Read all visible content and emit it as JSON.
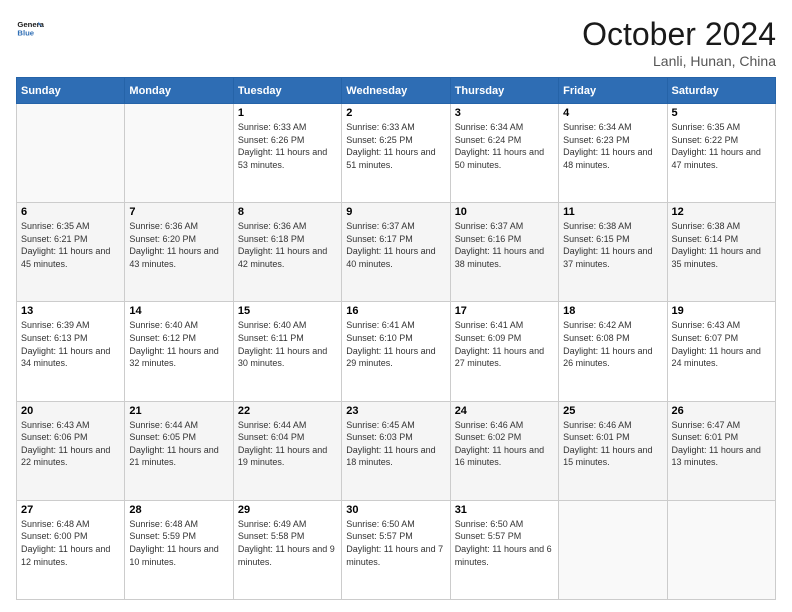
{
  "header": {
    "logo_line1": "General",
    "logo_line2": "Blue",
    "month": "October 2024",
    "location": "Lanli, Hunan, China"
  },
  "weekdays": [
    "Sunday",
    "Monday",
    "Tuesday",
    "Wednesday",
    "Thursday",
    "Friday",
    "Saturday"
  ],
  "weeks": [
    [
      {
        "day": "",
        "info": ""
      },
      {
        "day": "",
        "info": ""
      },
      {
        "day": "1",
        "info": "Sunrise: 6:33 AM\nSunset: 6:26 PM\nDaylight: 11 hours and 53 minutes."
      },
      {
        "day": "2",
        "info": "Sunrise: 6:33 AM\nSunset: 6:25 PM\nDaylight: 11 hours and 51 minutes."
      },
      {
        "day": "3",
        "info": "Sunrise: 6:34 AM\nSunset: 6:24 PM\nDaylight: 11 hours and 50 minutes."
      },
      {
        "day": "4",
        "info": "Sunrise: 6:34 AM\nSunset: 6:23 PM\nDaylight: 11 hours and 48 minutes."
      },
      {
        "day": "5",
        "info": "Sunrise: 6:35 AM\nSunset: 6:22 PM\nDaylight: 11 hours and 47 minutes."
      }
    ],
    [
      {
        "day": "6",
        "info": "Sunrise: 6:35 AM\nSunset: 6:21 PM\nDaylight: 11 hours and 45 minutes."
      },
      {
        "day": "7",
        "info": "Sunrise: 6:36 AM\nSunset: 6:20 PM\nDaylight: 11 hours and 43 minutes."
      },
      {
        "day": "8",
        "info": "Sunrise: 6:36 AM\nSunset: 6:18 PM\nDaylight: 11 hours and 42 minutes."
      },
      {
        "day": "9",
        "info": "Sunrise: 6:37 AM\nSunset: 6:17 PM\nDaylight: 11 hours and 40 minutes."
      },
      {
        "day": "10",
        "info": "Sunrise: 6:37 AM\nSunset: 6:16 PM\nDaylight: 11 hours and 38 minutes."
      },
      {
        "day": "11",
        "info": "Sunrise: 6:38 AM\nSunset: 6:15 PM\nDaylight: 11 hours and 37 minutes."
      },
      {
        "day": "12",
        "info": "Sunrise: 6:38 AM\nSunset: 6:14 PM\nDaylight: 11 hours and 35 minutes."
      }
    ],
    [
      {
        "day": "13",
        "info": "Sunrise: 6:39 AM\nSunset: 6:13 PM\nDaylight: 11 hours and 34 minutes."
      },
      {
        "day": "14",
        "info": "Sunrise: 6:40 AM\nSunset: 6:12 PM\nDaylight: 11 hours and 32 minutes."
      },
      {
        "day": "15",
        "info": "Sunrise: 6:40 AM\nSunset: 6:11 PM\nDaylight: 11 hours and 30 minutes."
      },
      {
        "day": "16",
        "info": "Sunrise: 6:41 AM\nSunset: 6:10 PM\nDaylight: 11 hours and 29 minutes."
      },
      {
        "day": "17",
        "info": "Sunrise: 6:41 AM\nSunset: 6:09 PM\nDaylight: 11 hours and 27 minutes."
      },
      {
        "day": "18",
        "info": "Sunrise: 6:42 AM\nSunset: 6:08 PM\nDaylight: 11 hours and 26 minutes."
      },
      {
        "day": "19",
        "info": "Sunrise: 6:43 AM\nSunset: 6:07 PM\nDaylight: 11 hours and 24 minutes."
      }
    ],
    [
      {
        "day": "20",
        "info": "Sunrise: 6:43 AM\nSunset: 6:06 PM\nDaylight: 11 hours and 22 minutes."
      },
      {
        "day": "21",
        "info": "Sunrise: 6:44 AM\nSunset: 6:05 PM\nDaylight: 11 hours and 21 minutes."
      },
      {
        "day": "22",
        "info": "Sunrise: 6:44 AM\nSunset: 6:04 PM\nDaylight: 11 hours and 19 minutes."
      },
      {
        "day": "23",
        "info": "Sunrise: 6:45 AM\nSunset: 6:03 PM\nDaylight: 11 hours and 18 minutes."
      },
      {
        "day": "24",
        "info": "Sunrise: 6:46 AM\nSunset: 6:02 PM\nDaylight: 11 hours and 16 minutes."
      },
      {
        "day": "25",
        "info": "Sunrise: 6:46 AM\nSunset: 6:01 PM\nDaylight: 11 hours and 15 minutes."
      },
      {
        "day": "26",
        "info": "Sunrise: 6:47 AM\nSunset: 6:01 PM\nDaylight: 11 hours and 13 minutes."
      }
    ],
    [
      {
        "day": "27",
        "info": "Sunrise: 6:48 AM\nSunset: 6:00 PM\nDaylight: 11 hours and 12 minutes."
      },
      {
        "day": "28",
        "info": "Sunrise: 6:48 AM\nSunset: 5:59 PM\nDaylight: 11 hours and 10 minutes."
      },
      {
        "day": "29",
        "info": "Sunrise: 6:49 AM\nSunset: 5:58 PM\nDaylight: 11 hours and 9 minutes."
      },
      {
        "day": "30",
        "info": "Sunrise: 6:50 AM\nSunset: 5:57 PM\nDaylight: 11 hours and 7 minutes."
      },
      {
        "day": "31",
        "info": "Sunrise: 6:50 AM\nSunset: 5:57 PM\nDaylight: 11 hours and 6 minutes."
      },
      {
        "day": "",
        "info": ""
      },
      {
        "day": "",
        "info": ""
      }
    ]
  ]
}
